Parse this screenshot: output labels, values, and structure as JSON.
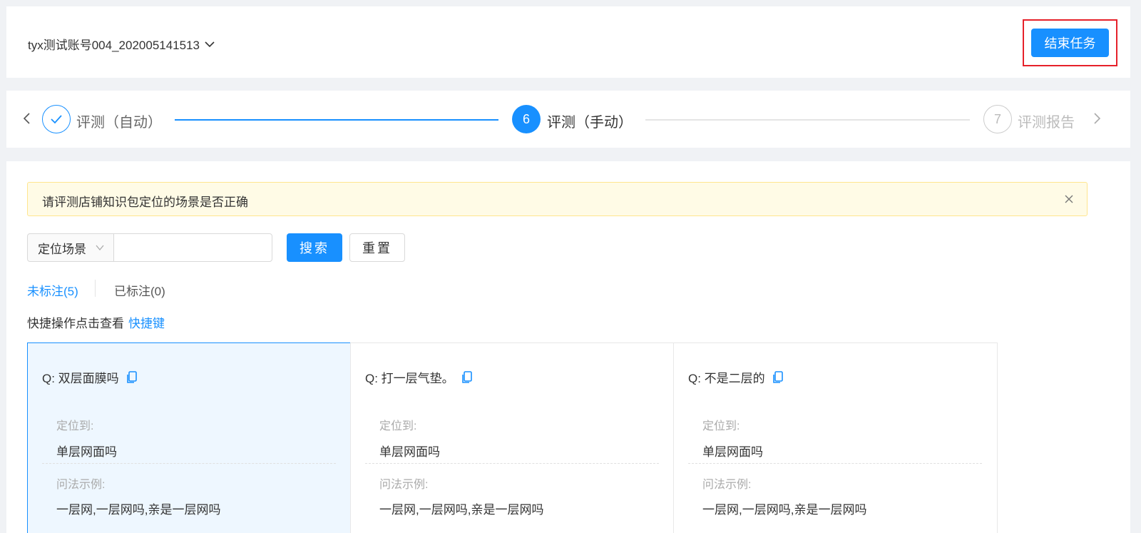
{
  "header": {
    "account_name": "tyx测试账号004_202005141513",
    "end_task_label": "结束任务"
  },
  "steps": {
    "items": [
      {
        "number": "",
        "label": "评测（自动）",
        "status": "done"
      },
      {
        "number": "6",
        "label": "评测（手动）",
        "status": "active"
      },
      {
        "number": "7",
        "label": "评测报告",
        "status": "wait"
      }
    ]
  },
  "alert": {
    "text": "请评测店铺知识包定位的场景是否正确"
  },
  "filter": {
    "select_value": "定位场景",
    "input_value": "",
    "input_placeholder": "",
    "search_label": "搜索",
    "reset_label": "重置"
  },
  "tabs": {
    "unmarked": "未标注(5)",
    "marked": "已标注(0)"
  },
  "shortcut": {
    "text": "快捷操作点击查看",
    "link": "快捷键"
  },
  "cards": [
    {
      "question": "Q: 双层面膜吗",
      "located_label": "定位到:",
      "located_value": "单层网面吗",
      "example_label": "问法示例:",
      "example_value": "一层网,一层网吗,亲是一层网吗",
      "selected": true
    },
    {
      "question": "Q: 打一层气垫。",
      "located_label": "定位到:",
      "located_value": "单层网面吗",
      "example_label": "问法示例:",
      "example_value": "一层网,一层网吗,亲是一层网吗",
      "selected": false
    },
    {
      "question": "Q: 不是二层的",
      "located_label": "定位到:",
      "located_value": "单层网面吗",
      "example_label": "问法示例:",
      "example_value": "一层网,一层网吗,亲是一层网吗",
      "selected": false
    }
  ],
  "colors": {
    "primary": "#1890ff",
    "highlight_border": "#e6212a",
    "alert_bg": "#fffbe6",
    "selected_card_bg": "#eef7ff"
  }
}
